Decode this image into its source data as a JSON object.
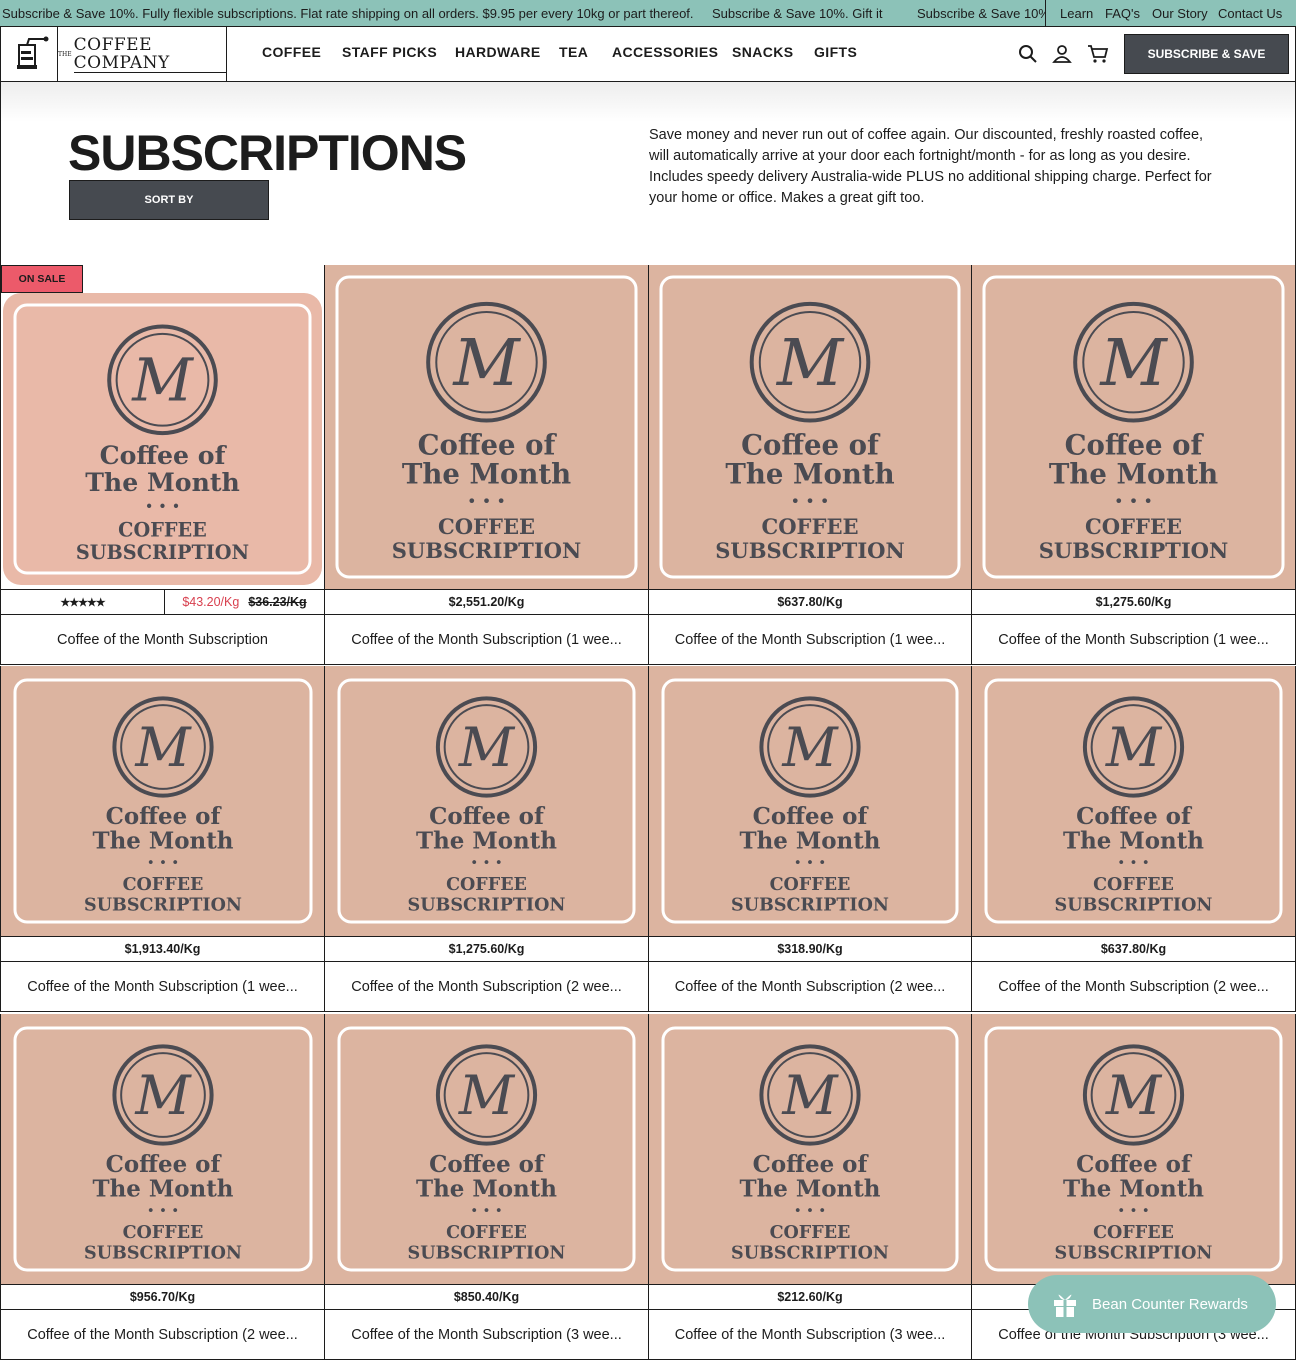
{
  "announcement": {
    "text_1": "Subscribe & Save 10%. Fully flexible subscriptions. Flat rate shipping on all orders. $9.95 per every 10kg or part thereof.",
    "text_2": "Subscribe & Save 10%. Gift it",
    "text_3": "Subscribe & Save 10%"
  },
  "top_links": [
    "Learn",
    "FAQ's",
    "Our Story",
    "Contact Us"
  ],
  "brand": {
    "logo_text": "COFFEE COMPANY",
    "logo_prefix": "THE"
  },
  "nav": [
    "COFFEE",
    "STAFF PICKS",
    "HARDWARE",
    "TEA",
    "ACCESSORIES",
    "SNACKS",
    "GIFTS"
  ],
  "header": {
    "subscribe_button": "SUBSCRIBE & SAVE",
    "icons": [
      "search-icon",
      "account-icon",
      "cart-icon"
    ]
  },
  "hero": {
    "title": "SUBSCRIPTIONS",
    "sort_label": "SORT BY",
    "description_lines": [
      "Save money and never run out of coffee again. Our discounted, freshly roasted coffee,",
      "will automatically arrive at your door each fortnight/month - for as long as you desire.",
      "Includes speedy delivery Australia-wide PLUS no additional shipping charge. Perfect for",
      "your home or office. Makes a great gift too."
    ]
  },
  "product_art": {
    "line1": "Coffee of",
    "line2": "The Month",
    "dots": "• • •",
    "line3": "COFFEE",
    "line4": "SUBSCRIPTION",
    "monogram": "M"
  },
  "products": [
    {
      "title": "Coffee of the Month Subscription",
      "badge": "ON SALE",
      "rating": "★★★★★",
      "price": "$43.20/Kg",
      "old_price": "$36.23/Kg"
    },
    {
      "title": "Coffee of the Month Subscription (1 wee...",
      "price": "$2,551.20/Kg"
    },
    {
      "title": "Coffee of the Month Subscription (1 wee...",
      "price": "$637.80/Kg"
    },
    {
      "title": "Coffee of the Month Subscription (1 wee...",
      "price": "$1,275.60/Kg"
    },
    {
      "title": "Coffee of the Month Subscription (1 wee...",
      "price": "$1,913.40/Kg"
    },
    {
      "title": "Coffee of the Month Subscription (2 wee...",
      "price": "$1,275.60/Kg"
    },
    {
      "title": "Coffee of the Month Subscription (2 wee...",
      "price": "$318.90/Kg"
    },
    {
      "title": "Coffee of the Month Subscription (2 wee...",
      "price": "$637.80/Kg"
    },
    {
      "title": "Coffee of the Month Subscription (2 wee...",
      "price": "$956.70/Kg"
    },
    {
      "title": "Coffee of the Month Subscription (3 wee...",
      "price": "$850.40/Kg"
    },
    {
      "title": "Coffee of the Month Subscription (3 wee...",
      "price": "$212.60/Kg"
    },
    {
      "title": "Coffee of the Month Subscription (3 wee...",
      "price": ""
    }
  ],
  "rewards": {
    "label": "Bean Counter Rewards"
  },
  "colors": {
    "announcement_bg": "#8cc2b8",
    "button_bg": "#464a50",
    "sale_badge": "#ec5a6a",
    "product_tan": "#dcb4a0",
    "product_pink": "#e9b9a8",
    "sale_price": "#d8404f"
  }
}
